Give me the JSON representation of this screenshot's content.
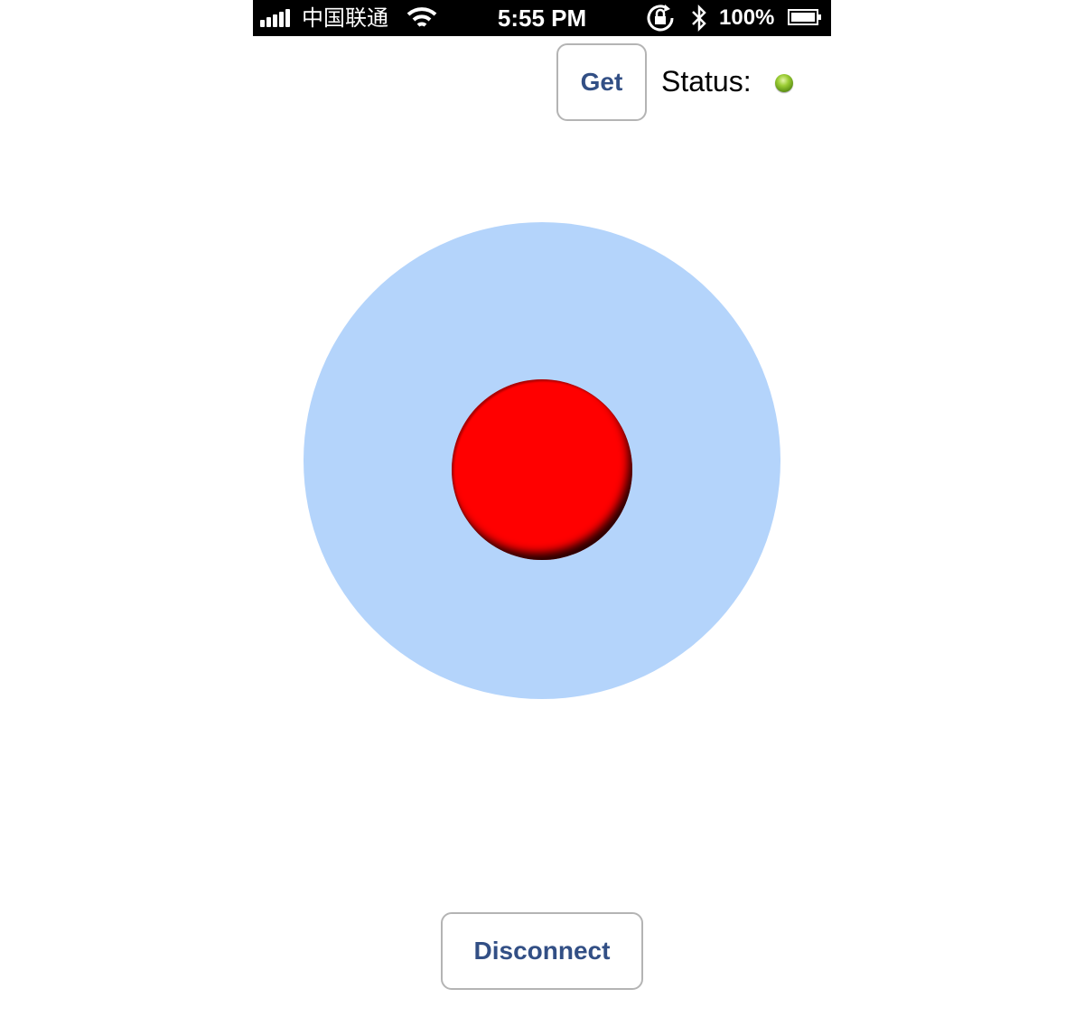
{
  "status_bar": {
    "carrier": "中国联通",
    "time": "5:55 PM",
    "battery": "100%",
    "icons": [
      "signal-icon",
      "wifi-icon",
      "rotation-lock-icon",
      "bluetooth-icon",
      "battery-icon"
    ]
  },
  "toolbar": {
    "get_label": "Get",
    "status_label": "Status:",
    "status_indicator_color": "#7ab82a"
  },
  "joystick": {
    "base_color": "#b4d4fb",
    "knob_color": "#ff0000"
  },
  "footer": {
    "disconnect_label": "Disconnect"
  },
  "colors": {
    "button_text": "#324f85",
    "button_border": "#b4b4b4"
  }
}
